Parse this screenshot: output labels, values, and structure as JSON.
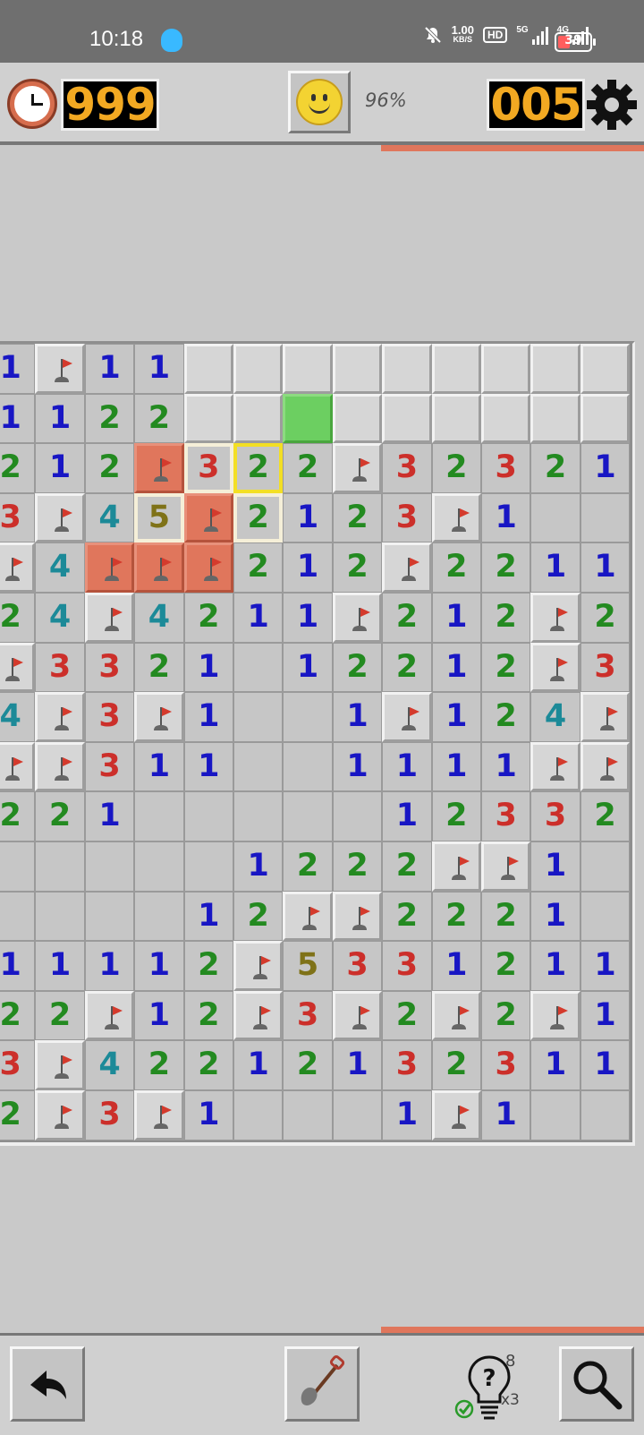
{
  "status_bar": {
    "time": "10:18",
    "net_speed": "1.00",
    "net_unit": "KB/S",
    "hd": "HD",
    "net1": "5G",
    "net2": "4G",
    "battery": "39"
  },
  "header": {
    "timer": "999",
    "mines_left": "005",
    "percent": "96%"
  },
  "icons": {
    "timer": "clock-icon",
    "face": "smiley-face-icon",
    "settings": "gear-icon",
    "undo": "undo-arrow-icon",
    "dig": "shovel-icon",
    "hint": "lightbulb-question-icon",
    "hint_check": "checkmark-icon",
    "zoom": "magnifier-icon",
    "flag": "flag-icon"
  },
  "hints": {
    "count": "8",
    "multiplier": "x3"
  },
  "colors": {
    "n1": "#1816c4",
    "n2": "#238a20",
    "n3": "#cc2f2a",
    "n4": "#1c8a98",
    "n5": "#7f7218",
    "accent": "#e0765c",
    "highlight": "#6ccf61",
    "selection": "#f3df24"
  },
  "board": {
    "rows_text": [
      "1F11.........",
      "1122.........",
      "212F322F32321",
      "3F45F2123F1__",
      "F4FFF212F2211",
      "24F42111F212F2",
      "F3321_1221 2F3",
      "4F3F1__1F124F",
      "FF311__1111FF",
      "221_____12332",
      "_____1222FF1_",
      "____12FF2221_",
      "11112F5331211",
      "22F12F3F2F2F1",
      "3F4221213231 1",
      "2F3F1___1F1__"
    ],
    "rows": [
      [
        "1",
        "F",
        "1",
        "1",
        "H",
        "H",
        "H",
        "H",
        "H",
        "H",
        "H",
        "H",
        "H"
      ],
      [
        "1",
        "1",
        "2",
        "2",
        "H",
        "H",
        "G",
        "H",
        "H",
        "H",
        "H",
        "H",
        "H"
      ],
      [
        "2",
        "1",
        "2",
        "OF",
        "3",
        "2",
        "2",
        "F",
        "3",
        "2",
        "3",
        "2",
        "1"
      ],
      [
        "3",
        "F",
        "4",
        "5",
        "OF",
        "2",
        "1",
        "2",
        "3",
        "F",
        "1",
        "",
        ""
      ],
      [
        "F",
        "4",
        "OF",
        "OF",
        "OF",
        "2",
        "1",
        "2",
        "F",
        "2",
        "2",
        "1",
        "1"
      ],
      [
        "2",
        "4",
        "F",
        "4",
        "2",
        "1",
        "1",
        "F",
        "2",
        "1",
        "2",
        "F",
        "2"
      ],
      [
        "F",
        "3",
        "3",
        "2",
        "1",
        "",
        "1",
        "2",
        "2",
        "1",
        "2",
        "F",
        "3"
      ],
      [
        "4",
        "F",
        "3",
        "F",
        "1",
        "",
        "",
        "1",
        "F",
        "1",
        "2",
        "4",
        "F"
      ],
      [
        "F",
        "F",
        "3",
        "1",
        "1",
        "",
        "",
        "1",
        "1",
        "1",
        "1",
        "F",
        "F"
      ],
      [
        "2",
        "2",
        "1",
        "",
        "",
        "",
        "",
        "",
        "1",
        "2",
        "3",
        "3",
        "2"
      ],
      [
        "",
        "",
        "",
        "",
        "",
        "1",
        "2",
        "2",
        "2",
        "F",
        "F",
        "1",
        ""
      ],
      [
        "",
        "",
        "",
        "",
        "1",
        "2",
        "F",
        "F",
        "2",
        "2",
        "2",
        "1",
        ""
      ],
      [
        "1",
        "1",
        "1",
        "1",
        "2",
        "F",
        "5",
        "3",
        "3",
        "1",
        "2",
        "1",
        "1"
      ],
      [
        "2",
        "2",
        "F",
        "1",
        "2",
        "F",
        "3",
        "F",
        "2",
        "F",
        "2",
        "F",
        "1"
      ],
      [
        "3",
        "F",
        "4",
        "2",
        "2",
        "1",
        "2",
        "1",
        "3",
        "2",
        "3",
        "1",
        "1"
      ],
      [
        "2",
        "F",
        "3",
        "F",
        "1",
        "",
        "",
        "",
        "1",
        "F",
        "1",
        "",
        ""
      ]
    ],
    "cream_cells": [
      [
        2,
        4
      ],
      [
        3,
        3
      ],
      [
        3,
        5
      ]
    ],
    "selected_cell": [
      2,
      5
    ]
  }
}
